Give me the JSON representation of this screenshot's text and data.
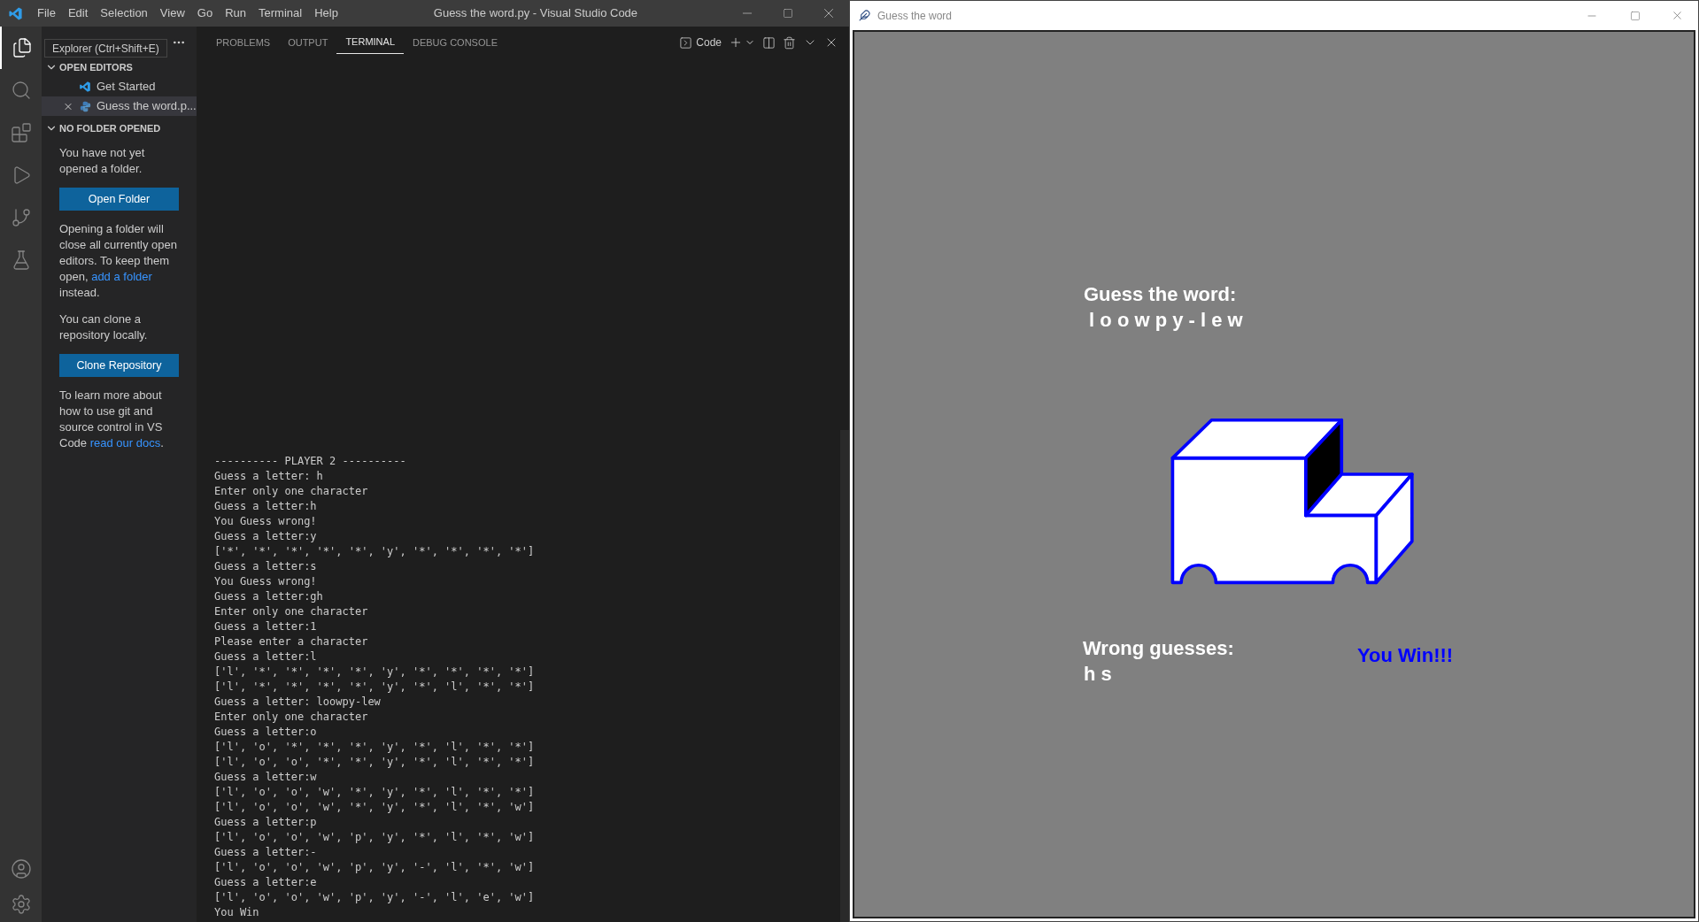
{
  "vscode": {
    "title": "Guess the word.py - Visual Studio Code",
    "menu": [
      "File",
      "Edit",
      "Selection",
      "View",
      "Go",
      "Run",
      "Terminal",
      "Help"
    ],
    "tooltip": "Explorer (Ctrl+Shift+E)",
    "explorer": {
      "open_editors": {
        "title": "OPEN EDITORS",
        "expanded": true,
        "items": [
          {
            "label": "Get Started",
            "kind": "vscode",
            "selected": false
          },
          {
            "label": "Guess the word.p...",
            "kind": "python",
            "selected": true
          }
        ]
      },
      "no_folder": {
        "title": "NO FOLDER OPENED",
        "expanded": true,
        "blocks": [
          {
            "kind": "text",
            "before": "You have not yet opened a folder."
          },
          {
            "kind": "button",
            "label": "Open Folder"
          },
          {
            "kind": "text",
            "before": "Opening a folder will close all currently open editors. To keep them open, ",
            "link": "add a folder",
            "after": " instead."
          },
          {
            "kind": "text",
            "before": "You can clone a repository locally."
          },
          {
            "kind": "button",
            "label": "Clone Repository"
          },
          {
            "kind": "text",
            "before": "To learn more about how to use git and source control in VS Code ",
            "link": "read our docs",
            "after": "."
          }
        ]
      }
    },
    "panel": {
      "tabs": [
        {
          "label": "PROBLEMS",
          "selected": false
        },
        {
          "label": "OUTPUT",
          "selected": false
        },
        {
          "label": "TERMINAL",
          "selected": true
        },
        {
          "label": "DEBUG CONSOLE",
          "selected": false
        }
      ],
      "terminal_profile": "Code",
      "lines": [
        "---------- PLAYER 2 ----------",
        "Guess a letter: h",
        "Enter only one character",
        "Guess a letter:h",
        "You Guess wrong!",
        "Guess a letter:y",
        "['*', '*', '*', '*', '*', 'y', '*', '*', '*', '*']",
        "Guess a letter:s",
        "You Guess wrong!",
        "Guess a letter:gh",
        "Enter only one character",
        "Guess a letter:1",
        "Please enter a character",
        "Guess a letter:l",
        "['l', '*', '*', '*', '*', 'y', '*', '*', '*', '*']",
        "['l', '*', '*', '*', '*', 'y', '*', 'l', '*', '*']",
        "Guess a letter: loowpy-lew",
        "Enter only one character",
        "Guess a letter:o",
        "['l', 'o', '*', '*', '*', 'y', '*', 'l', '*', '*']",
        "['l', 'o', 'o', '*', '*', 'y', '*', 'l', '*', '*']",
        "Guess a letter:w",
        "['l', 'o', 'o', 'w', '*', 'y', '*', 'l', '*', '*']",
        "['l', 'o', 'o', 'w', '*', 'y', '*', 'l', '*', 'w']",
        "Guess a letter:p",
        "['l', 'o', 'o', 'w', 'p', 'y', '*', 'l', '*', 'w']",
        "Guess a letter:-",
        "['l', 'o', 'o', 'w', 'p', 'y', '-', 'l', '*', 'w']",
        "Guess a letter:e",
        "['l', 'o', 'o', 'w', 'p', 'y', '-', 'l', 'e', 'w']",
        "You Win"
      ]
    }
  },
  "game_window": {
    "title": "Guess the word",
    "canvas": {
      "prompt": "Guess the word:",
      "word": " l o o w p y - l e w",
      "wrong_label": "Wrong guesses:",
      "wrong_letters": "h s",
      "result": "You Win!!!"
    }
  }
}
